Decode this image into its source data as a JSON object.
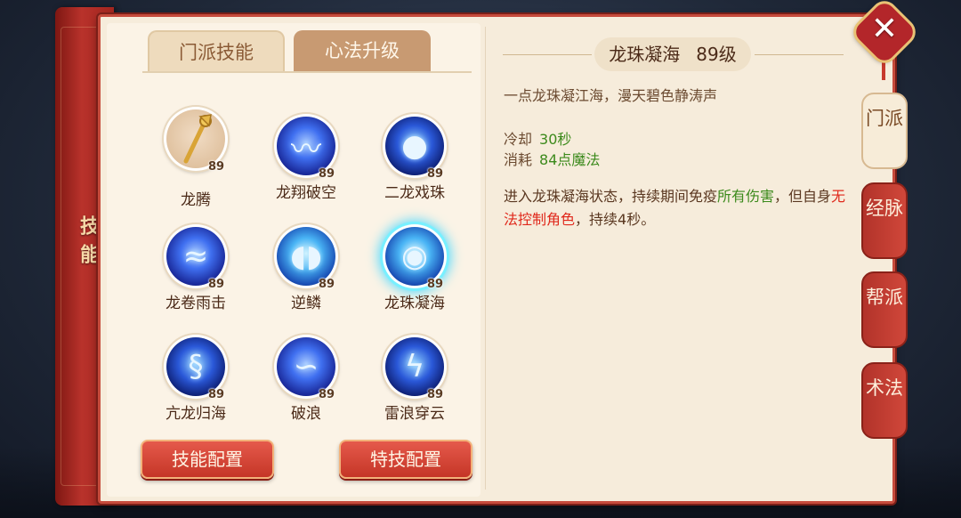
{
  "side_title": "技能",
  "tabs": [
    {
      "label": "门派技能",
      "active": true
    },
    {
      "label": "心法升级",
      "active": false
    }
  ],
  "skills": [
    {
      "name": "龙腾",
      "level": "89",
      "icon": "golden-staff-icon"
    },
    {
      "name": "龙翔破空",
      "level": "89",
      "icon": "blue-dragon-icon"
    },
    {
      "name": "二龙戏珠",
      "level": "89",
      "icon": "twin-dragon-orb-icon"
    },
    {
      "name": "龙卷雨击",
      "level": "89",
      "icon": "storm-dragon-icon"
    },
    {
      "name": "逆鳞",
      "level": "89",
      "icon": "scales-icon"
    },
    {
      "name": "龙珠凝海",
      "level": "89",
      "icon": "sea-orb-icon",
      "selected": true
    },
    {
      "name": "亢龙归海",
      "level": "89",
      "icon": "rising-dragon-icon"
    },
    {
      "name": "破浪",
      "level": "89",
      "icon": "wave-icon"
    },
    {
      "name": "雷浪穿云",
      "level": "89",
      "icon": "lightning-icon"
    }
  ],
  "buttons": {
    "skill_config": "技能配置",
    "special_config": "特技配置"
  },
  "detail": {
    "name": "龙珠凝海",
    "level": "89级",
    "description": "一点龙珠凝江海，漫天碧色静涛声",
    "cooldown_label": "冷却",
    "cooldown_value": "30秒",
    "cost_label": "消耗",
    "cost_value": "84点魔法",
    "effect_1": "进入龙珠凝海状态，持续期间免疫",
    "effect_highlight_1": "所有伤害",
    "effect_2": "，但自身",
    "effect_highlight_2": "无法控制角色",
    "effect_3": "，持续4秒。"
  },
  "side_tabs": [
    {
      "label": "门派",
      "active": true
    },
    {
      "label": "经脉",
      "active": false
    },
    {
      "label": "帮派",
      "active": false
    },
    {
      "label": "术法",
      "active": false
    }
  ],
  "colors": {
    "accent_red": "#c53627",
    "highlight_green": "#3c8a1c",
    "highlight_red": "#e0281b",
    "parchment": "#f6ecdb"
  }
}
